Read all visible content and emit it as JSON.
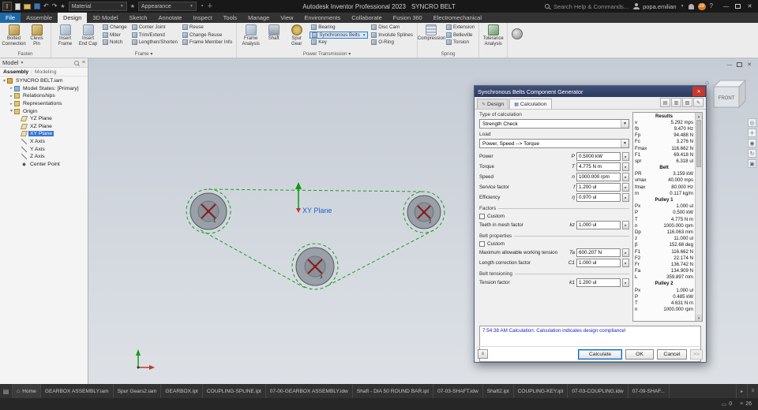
{
  "titlebar": {
    "app_title": "Autodesk Inventor Professional 2023",
    "doc_title": "SYNCRO BELT",
    "material": "Material",
    "appearance": "Appearance",
    "search_placeholder": "Search Help & Commands...",
    "user": "popa.emilian",
    "notification_count": "29"
  },
  "ribbon": {
    "tabs": [
      "File",
      "Assemble",
      "Design",
      "3D Model",
      "Sketch",
      "Annotate",
      "Inspect",
      "Tools",
      "Manage",
      "View",
      "Environments",
      "Collaborate",
      "Fusion 360",
      "Electromechanical"
    ],
    "active_tab": "Design",
    "groups": [
      {
        "label": "Fasten",
        "big": [
          {
            "name": "bolted-connection",
            "label": "Bolted\nConnection"
          },
          {
            "name": "clevis-pin",
            "label": "Clevis\nPin"
          }
        ],
        "cols": []
      },
      {
        "label": "Frame ▾",
        "big": [
          {
            "name": "insert-frame",
            "label": "Insert\nFrame"
          },
          {
            "name": "insert-end-cap",
            "label": "Insert\nEnd Cap"
          }
        ],
        "cols": [
          [
            "Change",
            "Miter",
            "Notch"
          ],
          [
            "Corner Joint",
            "Trim/Extend",
            "Lengthen/Shorten"
          ],
          [
            "Reuse",
            "Change Reuse",
            "Frame Member Info"
          ]
        ]
      },
      {
        "label": "Power Transmission ▾",
        "big": [
          {
            "name": "frame-analysis",
            "label": "Frame\nAnalysis"
          },
          {
            "name": "shaft",
            "label": "Shaft"
          },
          {
            "name": "spur-gear",
            "label": "Spur\nGear"
          }
        ],
        "cols": [
          [
            "Bearing",
            "Synchronous Belts",
            "Key"
          ],
          [
            "Disc Cam",
            "Involute Splines",
            "O-Ring"
          ]
        ],
        "highlight": "Synchronous Belts"
      },
      {
        "label": "Spring",
        "big": [
          {
            "name": "compression",
            "label": "Compression"
          }
        ],
        "cols": [
          [
            "Extension",
            "Belleville",
            "Torsion"
          ]
        ]
      },
      {
        "label": "",
        "big": [
          {
            "name": "tolerance-analysis",
            "label": "Tolerance\nAnalysis"
          }
        ],
        "cols": []
      }
    ]
  },
  "browser": {
    "title": "Model",
    "tabs": [
      "Assembly",
      "Modeling"
    ],
    "tree": [
      {
        "label": "SYNCRO BELT.iam",
        "lvl": 0,
        "icon": "assembly",
        "exp": true
      },
      {
        "label": "Model States: [Primary]",
        "lvl": 1,
        "icon": "states",
        "exp": false
      },
      {
        "label": "Relationships",
        "lvl": 1,
        "icon": "folder",
        "exp": false
      },
      {
        "label": "Representations",
        "lvl": 1,
        "icon": "folder",
        "exp": false
      },
      {
        "label": "Origin",
        "lvl": 1,
        "icon": "folder",
        "exp": true
      },
      {
        "label": "YZ Plane",
        "lvl": 2,
        "icon": "plane"
      },
      {
        "label": "XZ Plane",
        "lvl": 2,
        "icon": "plane"
      },
      {
        "label": "XY Plane",
        "lvl": 2,
        "icon": "plane",
        "selected": true
      },
      {
        "label": "X Axis",
        "lvl": 2,
        "icon": "axis"
      },
      {
        "label": "Y Axis",
        "lvl": 2,
        "icon": "axis"
      },
      {
        "label": "Z Axis",
        "lvl": 2,
        "icon": "axis"
      },
      {
        "label": "Center Point",
        "lvl": 2,
        "icon": "point"
      }
    ]
  },
  "viewport": {
    "plane_label": "XY Plane",
    "viewcube_face": "FRONT",
    "pulley_labels": [
      "1",
      "2",
      "3"
    ]
  },
  "dialog": {
    "title": "Synchronous Belts Component Generator",
    "tab_design": "Design",
    "tab_calculation": "Calculation",
    "type_label": "Type of calculation",
    "type_value": "Strength Check",
    "load_label": "Load",
    "load_value": "Power, Speed --> Torque",
    "fields": [
      {
        "label": "Power",
        "sym": "P",
        "value": "0.5000 kW"
      },
      {
        "label": "Torque",
        "sym": "T",
        "value": "4.775 N m"
      },
      {
        "label": "Speed",
        "sym": "n",
        "value": "1000.000 rpm"
      },
      {
        "label": "Service factor",
        "sym": "f",
        "value": "1.200 ul"
      },
      {
        "label": "Efficiency",
        "sym": "η",
        "value": "0.970 ul"
      }
    ],
    "factors_label": "Factors",
    "custom_label": "Custom",
    "factors_fields": [
      {
        "label": "Teeth in mesh factor",
        "sym": "kz",
        "value": "1.000 ul"
      }
    ],
    "belt_props_label": "Belt properties",
    "belt_props_fields": [
      {
        "label": "Maximum allowable working tension",
        "sym": "Ta",
        "value": "600.207 N"
      },
      {
        "label": "Length correction factor",
        "sym": "C1",
        "value": "1.000 ul"
      }
    ],
    "tension_label": "Belt tensioning",
    "tension_fields": [
      {
        "label": "Tension factor",
        "sym": "k1",
        "value": "1.200 ul"
      }
    ],
    "message": "7:54:38 AM Calculation: Calculation indicates design compliance!",
    "results_rows": [
      {
        "t": "h",
        "l": "Results"
      },
      {
        "t": "r",
        "l": "v",
        "v": "5.292 mps"
      },
      {
        "t": "r",
        "l": "fb",
        "v": "9.470 Hz"
      },
      {
        "t": "r",
        "l": "Fp",
        "v": "94.488 N"
      },
      {
        "t": "r",
        "l": "Fc",
        "v": "3.276 N"
      },
      {
        "t": "r",
        "l": "Fmax",
        "v": "116.662 N"
      },
      {
        "t": "r",
        "l": "F1",
        "v": "69.418 N"
      },
      {
        "t": "r",
        "l": "spr",
        "v": "6.318 ul"
      },
      {
        "t": "h",
        "l": "Belt"
      },
      {
        "t": "r",
        "l": "PR",
        "v": "3.159 kW"
      },
      {
        "t": "r",
        "l": "vmax",
        "v": "40.000 mps"
      },
      {
        "t": "r",
        "l": "fmax",
        "v": "80.000 Hz"
      },
      {
        "t": "r",
        "l": "m",
        "v": "0.117 kg/m"
      },
      {
        "t": "h",
        "l": "Pulley 1"
      },
      {
        "t": "r",
        "l": "Px",
        "v": "1.000 ul"
      },
      {
        "t": "r",
        "l": "P",
        "v": "0.500 kW"
      },
      {
        "t": "r",
        "l": "T",
        "v": "4.775 N m"
      },
      {
        "t": "r",
        "l": "n",
        "v": "1000.000 rpm"
      },
      {
        "t": "r",
        "l": "Dp",
        "v": "116.063 mm"
      },
      {
        "t": "r",
        "l": "z",
        "v": "11.000 ul"
      },
      {
        "t": "r",
        "l": "β",
        "v": "152.68 deg"
      },
      {
        "t": "r",
        "l": "F1",
        "v": "116.662 N"
      },
      {
        "t": "r",
        "l": "F2",
        "v": "22.174 N"
      },
      {
        "t": "r",
        "l": "Fr",
        "v": "136.742 N"
      },
      {
        "t": "r",
        "l": "Fa",
        "v": "134.909 N"
      },
      {
        "t": "r",
        "l": "L",
        "v": "359.897 mm"
      },
      {
        "t": "h",
        "l": "Pulley 2"
      },
      {
        "t": "r",
        "l": "Px",
        "v": "1.000 ul"
      },
      {
        "t": "r",
        "l": "P",
        "v": "0.485 kW"
      },
      {
        "t": "r",
        "l": "T",
        "v": "4.631 N m"
      },
      {
        "t": "r",
        "l": "n",
        "v": "1000.000 rpm"
      }
    ],
    "buttons": {
      "calculate": "Calculate",
      "ok": "OK",
      "cancel": "Cancel",
      "more": ">>"
    }
  },
  "doc_tabs": {
    "home": "Home",
    "files": [
      "GEARBOX ASSEMBLY.iam",
      "Spur Gears2.iam",
      "GEARBOX.ipt",
      "COUPLING-SPLINE.ipt",
      "07-00-GEARBOX ASSEMBLY.idw",
      "Shaft - DIA 50 ROUND BAR.ipt",
      "07-03-SHAFT.idw",
      "Shaft2.ipt",
      "COUPLING-KEY.ipt",
      "07-03-COUPLING.idw",
      "07-09-SHAF..."
    ]
  },
  "statusbar": {
    "count_a": "0",
    "count_b": "26"
  }
}
